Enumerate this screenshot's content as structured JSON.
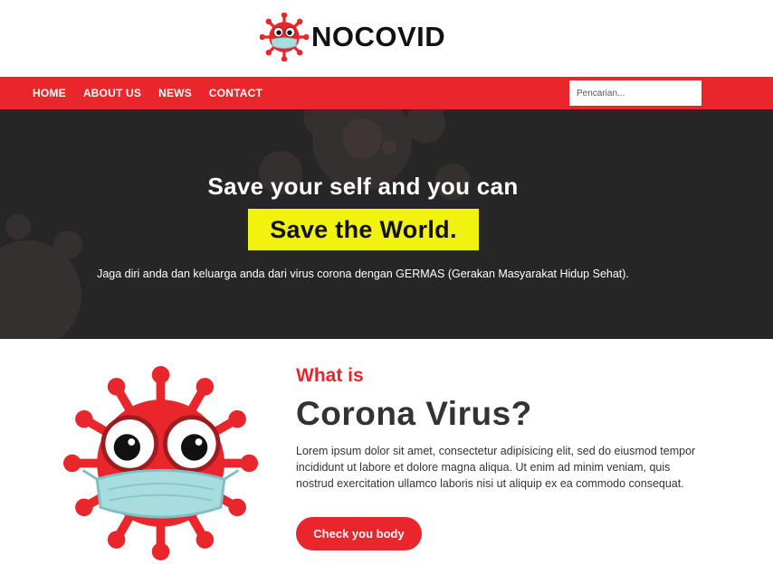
{
  "brand": {
    "name": "NOCOVID",
    "icon": "virus-mascot-icon"
  },
  "nav": {
    "items": [
      {
        "label": "HOME"
      },
      {
        "label": "ABOUT US"
      },
      {
        "label": "NEWS"
      },
      {
        "label": "CONTACT"
      }
    ],
    "search": {
      "placeholder": "Pencarian...",
      "value": ""
    }
  },
  "hero": {
    "title": "Save your self and you can",
    "highlight": "Save the World.",
    "subtitle": "Jaga diri anda dan keluarga anda dari virus corona dengan GERMAS (Gerakan Masyarakat Hidup Sehat).",
    "background_icon": "virus-silhouette-icon"
  },
  "about": {
    "kicker": "What is",
    "title": "Corona Virus?",
    "body": "Lorem ipsum dolor sit amet, consectetur adipisicing elit, sed do eiusmod tempor incididunt ut labore et dolore magna aliqua. Ut enim ad minim veniam, quis nostrud exercitation ullamco laboris nisi ut aliquip ex ea commodo consequat.",
    "button_label": "Check you body",
    "illustration_icon": "masked-virus-mascot-icon"
  },
  "colors": {
    "accent": "#e8262b",
    "hero_bg": "#262626",
    "highlight": "#f2f20f",
    "mask": "#a8dde0",
    "text_dark": "#333333"
  }
}
